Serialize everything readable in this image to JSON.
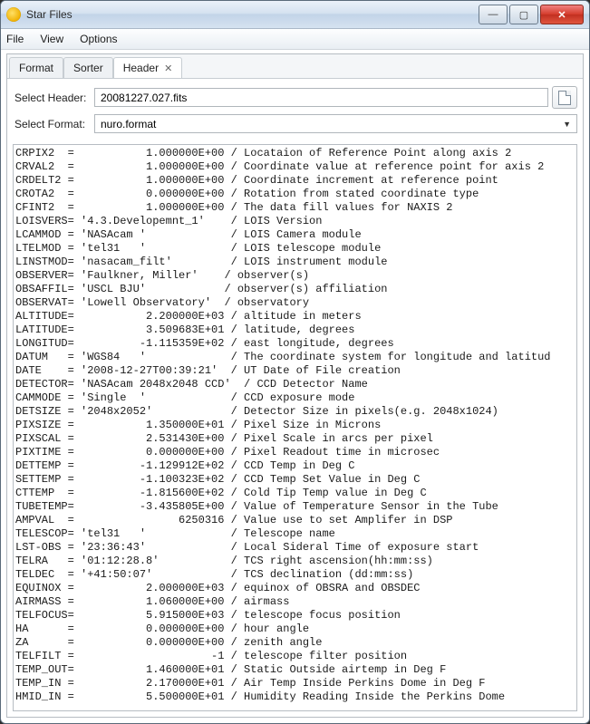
{
  "window": {
    "title": "Star Files"
  },
  "menubar": [
    "File",
    "View",
    "Options"
  ],
  "tabs": [
    {
      "label": "Format",
      "active": false
    },
    {
      "label": "Sorter",
      "active": false
    },
    {
      "label": "Header",
      "active": true,
      "closable": true
    }
  ],
  "form": {
    "select_header_label": "Select Header:",
    "select_header_value": "20081227.027.fits",
    "select_format_label": "Select Format:",
    "select_format_value": "nuro.format"
  },
  "header_rows": [
    {
      "key": "CRPIX2",
      "sep": "=",
      "val": "          1.000000E+00",
      "com": "Locataion of Reference Point along axis 2"
    },
    {
      "key": "CRVAL2",
      "sep": "=",
      "val": "          1.000000E+00",
      "com": "Coordinate value at reference point for axis 2"
    },
    {
      "key": "CRDELT2",
      "sep": "=",
      "val": "          1.000000E+00",
      "com": "Coordinate increment at reference point"
    },
    {
      "key": "CROTA2",
      "sep": "=",
      "val": "          0.000000E+00",
      "com": "Rotation from stated coordinate type"
    },
    {
      "key": "CFINT2",
      "sep": "=",
      "val": "          1.000000E+00",
      "com": "The data fill values for NAXIS 2"
    },
    {
      "key": "LOISVERS",
      "sep": "=",
      "val": "'4.3.Developemnt_1'   ",
      "com": "LOIS Version"
    },
    {
      "key": "LCAMMOD",
      "sep": "=",
      "val": "'NASAcam '            ",
      "com": "LOIS Camera module"
    },
    {
      "key": "LTELMOD",
      "sep": "=",
      "val": "'tel31   '            ",
      "com": "LOIS telescope module"
    },
    {
      "key": "LINSTMOD",
      "sep": "=",
      "val": "'nasacam_filt'        ",
      "com": "LOIS instrument module"
    },
    {
      "key": "OBSERVER",
      "sep": "=",
      "val": "'Faulkner, Miller'   ",
      "com": "observer(s)"
    },
    {
      "key": "OBSAFFIL",
      "sep": "=",
      "val": "'USCL BJU'           ",
      "com": "observer(s) affiliation"
    },
    {
      "key": "OBSERVAT",
      "sep": "=",
      "val": "'Lowell Observatory' ",
      "com": "observatory"
    },
    {
      "key": "ALTITUDE",
      "sep": "=",
      "val": "          2.200000E+03",
      "com": "altitude in meters"
    },
    {
      "key": "LATITUDE",
      "sep": "=",
      "val": "          3.509683E+01",
      "com": "latitude, degrees"
    },
    {
      "key": "LONGITUD",
      "sep": "=",
      "val": "         -1.115359E+02",
      "com": "east longitude, degrees"
    },
    {
      "key": "DATUM",
      "sep": "=",
      "val": "'WGS84   '            ",
      "com": "The coordinate system for longitude and latitud"
    },
    {
      "key": "DATE",
      "sep": "=",
      "val": "'2008-12-27T00:39:21' ",
      "com": "UT Date of File creation"
    },
    {
      "key": "DETECTOR",
      "sep": "=",
      "val": "'NASAcam 2048x2048 CCD' ",
      "com": "CCD Detector Name"
    },
    {
      "key": "CAMMODE",
      "sep": "=",
      "val": "'Single  '            ",
      "com": "CCD exposure mode"
    },
    {
      "key": "DETSIZE",
      "sep": "=",
      "val": "'2048x2052'           ",
      "com": "Detector Size in pixels(e.g. 2048x1024)"
    },
    {
      "key": "PIXSIZE",
      "sep": "=",
      "val": "          1.350000E+01",
      "com": "Pixel Size in Microns"
    },
    {
      "key": "PIXSCAL",
      "sep": "=",
      "val": "          2.531430E+00",
      "com": "Pixel Scale in arcs per pixel"
    },
    {
      "key": "PIXTIME",
      "sep": "=",
      "val": "          0.000000E+00",
      "com": "Pixel Readout time in microsec"
    },
    {
      "key": "DETTEMP",
      "sep": "=",
      "val": "         -1.129912E+02",
      "com": "CCD Temp in Deg C"
    },
    {
      "key": "SETTEMP",
      "sep": "=",
      "val": "         -1.100323E+02",
      "com": "CCD Temp Set Value in Deg C"
    },
    {
      "key": "CTTEMP",
      "sep": "=",
      "val": "         -1.815600E+02",
      "com": "Cold Tip Temp value in Deg C"
    },
    {
      "key": "TUBETEMP",
      "sep": "=",
      "val": "         -3.435805E+00",
      "com": "Value of Temperature Sensor in the Tube"
    },
    {
      "key": "AMPVAL",
      "sep": "=",
      "val": "               6250316",
      "com": "Value use to set Amplifer in DSP"
    },
    {
      "key": "TELESCOP",
      "sep": "=",
      "val": "'tel31   '            ",
      "com": "Telescope name"
    },
    {
      "key": "LST-OBS",
      "sep": "=",
      "val": "'23:36:43'            ",
      "com": "Local Sideral Time of exposure start"
    },
    {
      "key": "TELRA",
      "sep": "=",
      "val": "'01:12:28.8'          ",
      "com": "TCS right ascension(hh:mm:ss)"
    },
    {
      "key": "TELDEC",
      "sep": "=",
      "val": "'+41:50:07'           ",
      "com": "TCS declination (dd:mm:ss)"
    },
    {
      "key": "EQUINOX",
      "sep": "=",
      "val": "          2.000000E+03",
      "com": "equinox of OBSRA and OBSDEC"
    },
    {
      "key": "AIRMASS",
      "sep": "=",
      "val": "          1.060000E+00",
      "com": "airmass"
    },
    {
      "key": "TELFOCUS",
      "sep": "=",
      "val": "          5.915000E+03",
      "com": "telescope focus position"
    },
    {
      "key": "HA",
      "sep": "=",
      "val": "          0.000000E+00",
      "com": "hour angle"
    },
    {
      "key": "ZA",
      "sep": "=",
      "val": "          0.000000E+00",
      "com": "zenith angle"
    },
    {
      "key": "TELFILT",
      "sep": "=",
      "val": "                    -1",
      "com": "telescope filter position"
    },
    {
      "key": "TEMP_OUT",
      "sep": "=",
      "val": "          1.460000E+01",
      "com": "Static Outside airtemp in Deg F"
    },
    {
      "key": "TEMP_IN",
      "sep": "=",
      "val": "          2.170000E+01",
      "com": "Air Temp Inside Perkins Dome in Deg F"
    },
    {
      "key": "HMID_IN",
      "sep": "=",
      "val": "          5.500000E+01",
      "com": "Humidity Reading Inside the Perkins Dome"
    }
  ]
}
